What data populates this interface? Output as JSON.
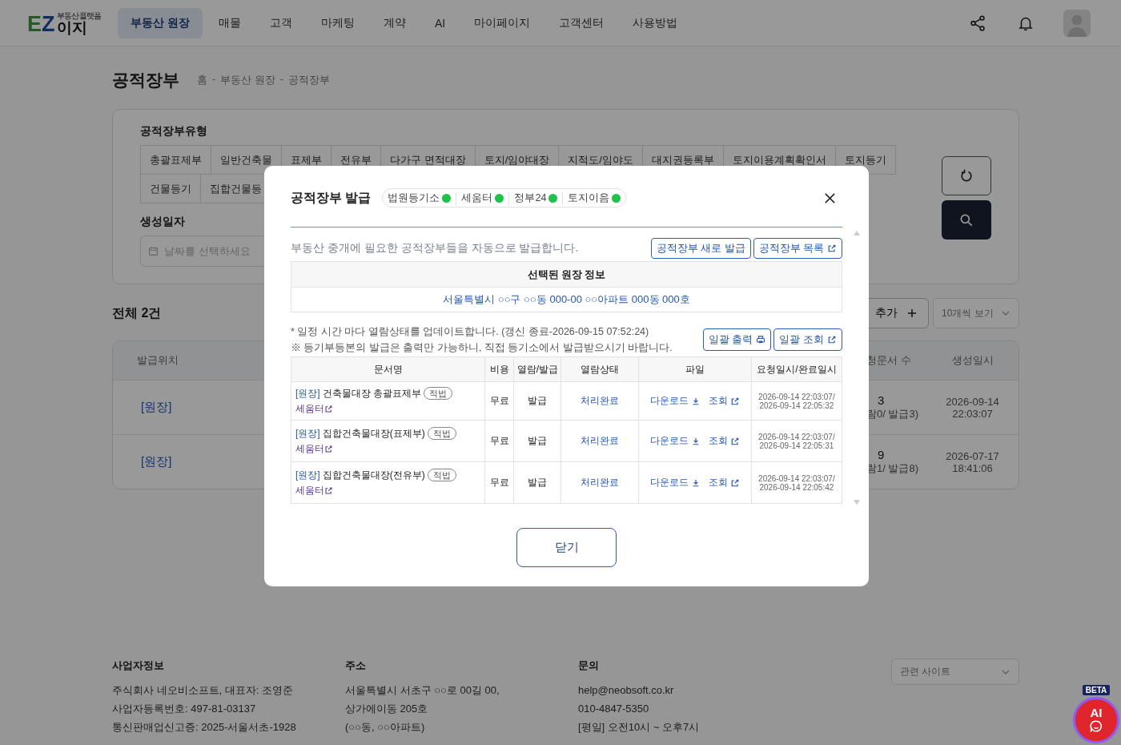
{
  "nav": {
    "logo": {
      "mark": "EZ",
      "tagline": "부동산 플랫폼",
      "name": "이지"
    },
    "items": [
      {
        "label": "부동산 원장",
        "selected": true
      },
      {
        "label": "매물",
        "selected": false
      },
      {
        "label": "고객",
        "selected": false
      },
      {
        "label": "마케팅",
        "selected": false
      },
      {
        "label": "계약",
        "selected": false
      },
      {
        "label": "AI",
        "selected": false
      },
      {
        "label": "마이페이지",
        "selected": false
      },
      {
        "label": "고객센터",
        "selected": false
      },
      {
        "label": "사용방법",
        "selected": false
      }
    ]
  },
  "page": {
    "title": "공적장부",
    "breadcrumb": [
      "홈",
      "부동산 원장",
      "공적장부"
    ],
    "breadcrumb_separator": "-"
  },
  "filter": {
    "type_label": "공적장부유형",
    "type_rows": [
      {
        "tabs": [
          {
            "label": "총괄표제부",
            "selected": false
          },
          {
            "label": "일반건축물",
            "selected": false
          },
          {
            "label": "표제부",
            "selected": false
          },
          {
            "label": "전유부",
            "selected": false
          },
          {
            "label": "다가구 면적대장",
            "selected": false
          },
          {
            "label": "토지/임야대장",
            "selected": false
          },
          {
            "label": "지적도/임야도",
            "selected": false
          },
          {
            "label": "대지권등록부",
            "selected": false
          },
          {
            "label": "토지이용계획확인서",
            "selected": false
          },
          {
            "label": "토지등기",
            "selected": false
          }
        ]
      },
      {
        "tabs": [
          {
            "label": "건물등기",
            "selected": false
          },
          {
            "label": "집합건물등",
            "selected": false
          }
        ]
      }
    ],
    "date_label": "생성일자",
    "date_placeholder": "날짜를 선택하세요"
  },
  "list": {
    "total": "전체 2건",
    "add_button": "추가",
    "page_size": "10개씩 보기",
    "columns": [
      "발급위치",
      "청문서 수",
      "생성일시"
    ],
    "rows": [
      {
        "location": "[원장]",
        "count": "3",
        "count_detail": "람0/ 발급3)",
        "created_date": "2026-09-14",
        "created_time": "22:03:07"
      },
      {
        "location": "[원장]",
        "count": "9",
        "count_detail": "람1/ 발급8)",
        "created_date": "2026-07-17",
        "created_time": "18:41:06"
      }
    ]
  },
  "footer": {
    "sections": [
      {
        "title": "사업자정보",
        "lines": [
          "주식회사 네오비소프트, 대표자: 조영준",
          "사업자등록번호: 497-81-03137",
          "통신판매업신고증: 2025-서울서초-1928"
        ]
      },
      {
        "title": "주소",
        "lines": [
          "서울특별시 서초구 ○○로 00길 00,",
          "상가에이동 205호",
          "(○○동, ○○아파트)"
        ]
      },
      {
        "title": "문의",
        "lines": [
          "help@neobsoft.co.kr",
          "010-4847-5350",
          "[평일] 오전10시 ~ 오후7시"
        ]
      }
    ],
    "related_sites": "관련 사이트"
  },
  "ai_button": {
    "label": "AI",
    "badge": "BETA"
  },
  "modal": {
    "title": "공적장부 발급",
    "services": [
      {
        "name": "법원등기소",
        "online": true
      },
      {
        "name": "세움터",
        "online": true
      },
      {
        "name": "정부24",
        "online": true
      },
      {
        "name": "토지이음",
        "online": true
      }
    ],
    "description": "부동산 중개에 필요한 공적장부들을 자동으로 발급합니다.",
    "top_buttons": [
      {
        "label": "공적장부 새로 발급",
        "external": false
      },
      {
        "label": "공적장부 목록",
        "external": true
      }
    ],
    "info_header": "선택된 원장 정보",
    "info_address": "서울특별시 ○○구 ○○동 000-00 ○○아파트 000동 000호",
    "notes": [
      "* 일정 시간 마다 열람상태를 업데이트합니다. (갱신 종료-2026-09-15 07:52:24)",
      "※ 등기부등본의 발급은 출력만 가능하니, 직접 등기소에서 발급받으시기 바랍니다."
    ],
    "bulk_buttons": [
      {
        "label": "일괄 출력",
        "kind": "print"
      },
      {
        "label": "일괄 조회",
        "kind": "external"
      }
    ],
    "columns": [
      "문서명",
      "비용",
      "열람/발급",
      "열람상태",
      "파일",
      "요청일시/완료일시"
    ],
    "rows": [
      {
        "prefix": "[원장]",
        "name": "건축물대장 총괄표제부",
        "badge": "적법",
        "source": "세움터",
        "cost": "무료",
        "type": "발급",
        "status": "처리완료",
        "download": "다운로드",
        "view": "조회",
        "requested": "2026-09-14 22:03:07/",
        "completed": "2026-09-14 22:05:32"
      },
      {
        "prefix": "[원장]",
        "name": "집합건축물대장(표제부)",
        "badge": "적법",
        "source": "세움터",
        "cost": "무료",
        "type": "발급",
        "status": "처리완료",
        "download": "다운로드",
        "view": "조회",
        "requested": "2026-09-14 22:03:07/",
        "completed": "2026-09-14 22:05:31"
      },
      {
        "prefix": "[원장]",
        "name": "집합건축물대장(전유부)",
        "badge": "적법",
        "source": "세움터",
        "cost": "무료",
        "type": "발급",
        "status": "처리완료",
        "download": "다운로드",
        "view": "조회",
        "requested": "2026-09-14 22:03:07/",
        "completed": "2026-09-14 22:05:42"
      }
    ],
    "close_button": "닫기"
  }
}
